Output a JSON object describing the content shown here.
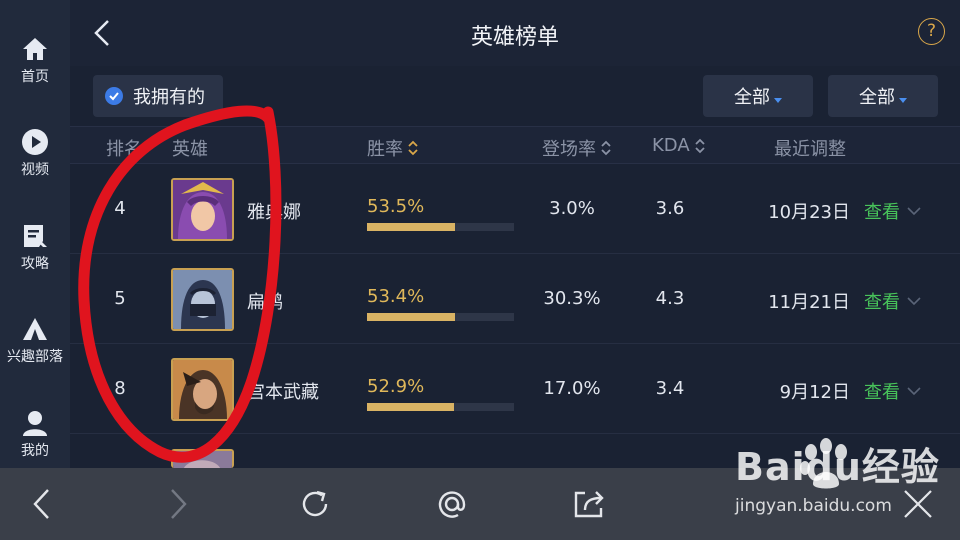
{
  "header": {
    "title": "英雄榜单",
    "back_icon": "chevron-left-icon",
    "help_label": "?"
  },
  "nav": {
    "items": [
      {
        "label": "首页",
        "icon": "home-icon"
      },
      {
        "label": "视频",
        "icon": "play-icon"
      },
      {
        "label": "攻略",
        "icon": "guide-icon"
      },
      {
        "label": "兴趣部落",
        "icon": "tent-icon"
      },
      {
        "label": "我的",
        "icon": "user-icon"
      }
    ]
  },
  "filters": {
    "owned_label": "我拥有的",
    "owned_checked": true,
    "dropdown1": "全部",
    "dropdown2": "全部"
  },
  "table": {
    "columns": [
      "排名",
      "英雄",
      "胜率",
      "登场率",
      "KDA",
      "最近调整"
    ],
    "rows": [
      {
        "rank": "4",
        "hero": "雅典娜",
        "winrate": "53.5%",
        "winrate_value": 0.535,
        "appearance": "3.0%",
        "kda": "3.6",
        "adjusted": "10月23日",
        "action": "查看"
      },
      {
        "rank": "5",
        "hero": "扁鹊",
        "winrate": "53.4%",
        "winrate_value": 0.534,
        "appearance": "30.3%",
        "kda": "4.3",
        "adjusted": "11月21日",
        "action": "查看"
      },
      {
        "rank": "8",
        "hero": "宫本武藏",
        "winrate": "52.9%",
        "winrate_value": 0.529,
        "appearance": "17.0%",
        "kda": "3.4",
        "adjusted": "9月12日",
        "action": "查看"
      }
    ]
  },
  "watermark": {
    "brand": "Baidu经验",
    "url": "jingyan.baidu.com"
  },
  "colors": {
    "accent_gold": "#d9b364",
    "action_green": "#48c45a",
    "annotation_red": "#e0141e"
  }
}
